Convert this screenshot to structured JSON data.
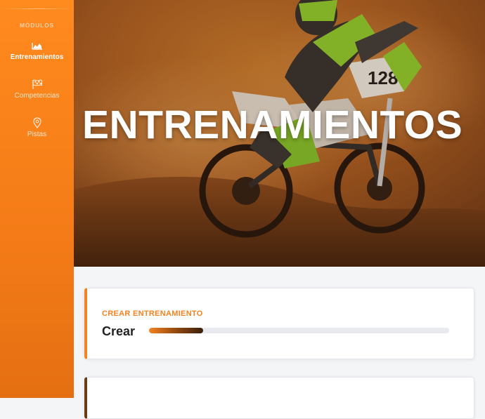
{
  "sidebar": {
    "section_label": "MÓDULOS",
    "items": [
      {
        "label": "Entrenamientos",
        "icon": "area-chart-icon",
        "active": true
      },
      {
        "label": "Competencias",
        "icon": "checkered-flag-icon",
        "active": false
      },
      {
        "label": "Pistas",
        "icon": "map-pin-icon",
        "active": false
      }
    ]
  },
  "hero": {
    "title": "ENTRENAMIENTOS",
    "rider_number": "128"
  },
  "card": {
    "subtitle": "CREAR ENTRENAMIENTO",
    "title": "Crear",
    "progress_percent": 18
  },
  "colors": {
    "accent": "#f58220",
    "sidebar": "#ff8a1e",
    "progress_track": "#e8eaf0",
    "progress_end": "#3b1f0c"
  }
}
